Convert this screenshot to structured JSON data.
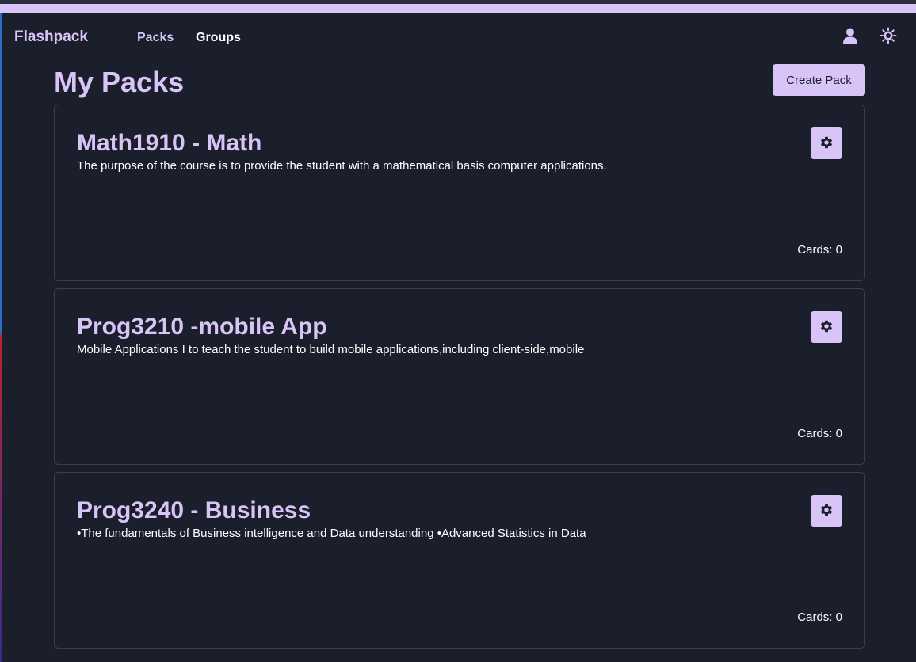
{
  "nav": {
    "brand": "Flashpack",
    "links": [
      {
        "label": "Packs"
      },
      {
        "label": "Groups"
      }
    ],
    "icons": {
      "user": "user-icon",
      "theme": "sun-icon"
    }
  },
  "page": {
    "title": "My Packs",
    "create_label": "Create Pack"
  },
  "packs": [
    {
      "title": "Math1910 - Math",
      "description": "The purpose of the course is to provide the student with a mathematical basis computer applications.",
      "cards": "Cards: 0"
    },
    {
      "title": "Prog3210 -mobile App",
      "description": "Mobile Applications I to teach the student to build mobile applications,including client-side,mobile",
      "cards": "Cards: 0"
    },
    {
      "title": "Prog3240 - Business",
      "description": "•The fundamentals of Business intelligence and Data understanding •Advanced Statistics in Data",
      "cards": "Cards: 0"
    }
  ],
  "colors": {
    "background": "#1b1f2b",
    "accent": "#d8c4f7",
    "border": "#3a3f4c",
    "text": "#ffffff"
  }
}
